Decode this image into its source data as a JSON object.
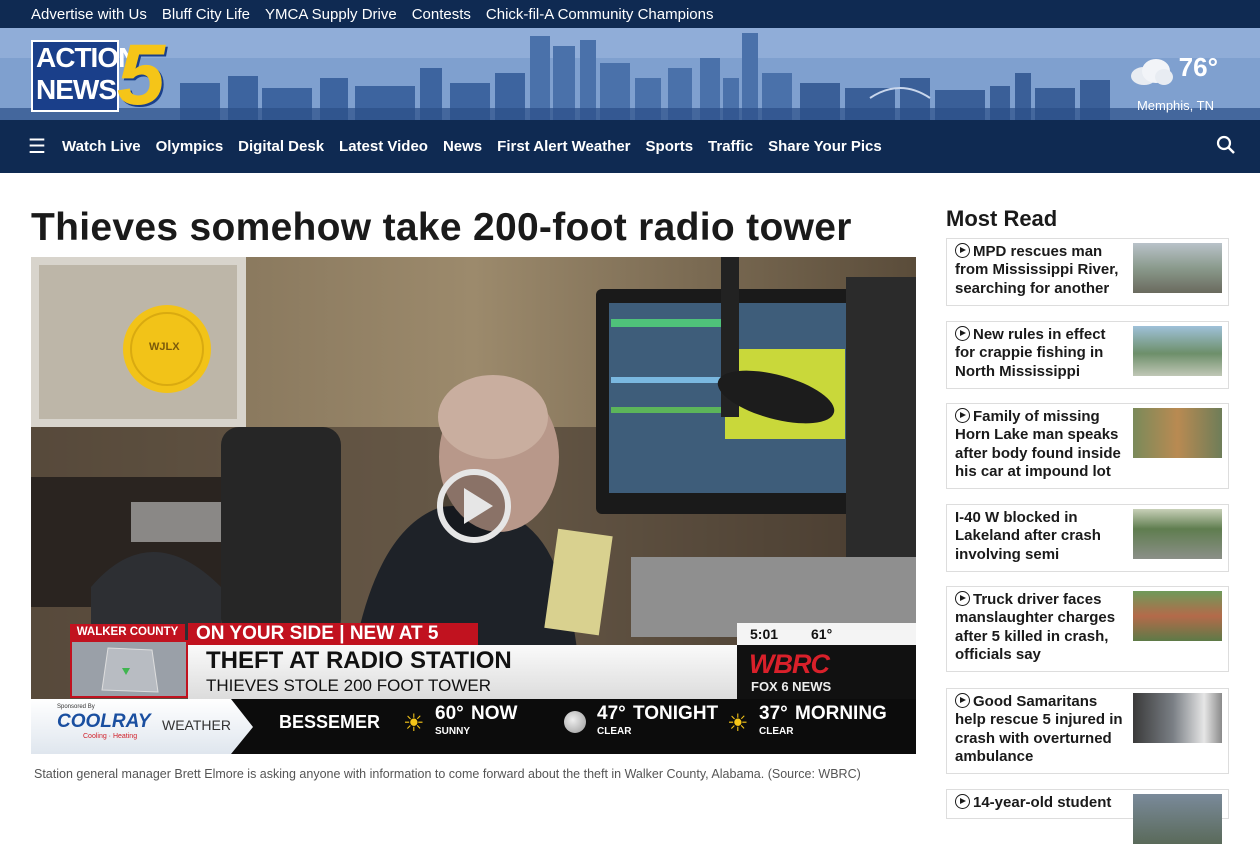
{
  "topbar": {
    "links": [
      "Advertise with Us",
      "Bluff City Life",
      "YMCA Supply Drive",
      "Contests",
      "Chick-fil-A Community Champions"
    ]
  },
  "logo": {
    "line1": "ACTION",
    "line2": "NEWS",
    "number": "5"
  },
  "weather": {
    "temp": "76°",
    "city": "Memphis, TN",
    "icon": "cloud-icon"
  },
  "nav": {
    "items": [
      "Watch Live",
      "Olympics",
      "Digital Desk",
      "Latest Video",
      "News",
      "First Alert Weather",
      "Sports",
      "Traffic",
      "Share Your Pics"
    ]
  },
  "article": {
    "headline": "Thieves somehow take 200-foot radio tower",
    "caption": "Station general manager Brett Elmore is asking anyone with information to come forward about the theft in Walker County, Alabama. (Source: WBRC)"
  },
  "video": {
    "frisbee_text": "WJLX",
    "county_tag": "WALKER COUNTY",
    "banner_top": "ON YOUR SIDE | NEW AT 5",
    "headline": "THEFT AT RADIO STATION",
    "subhead": "THIEVES STOLE 200 FOOT TOWER",
    "time": "5:01",
    "temp": "61°",
    "station": "WBRC",
    "station_sub": "FOX 6 NEWS",
    "sponsor_small": "Sponsored By",
    "sponsor": "COOLRAY",
    "sponsor_sub": "Cooling · Heating",
    "weather_label": "WEATHER",
    "city": "BESSEMER",
    "forecast": [
      {
        "temp": "60°",
        "when": "NOW",
        "cond": "SUNNY"
      },
      {
        "temp": "47°",
        "when": "TONIGHT",
        "cond": "CLEAR"
      },
      {
        "temp": "37°",
        "when": "MORNING",
        "cond": "CLEAR"
      }
    ]
  },
  "sidebar": {
    "title": "Most Read",
    "items": [
      {
        "text": "MPD rescues man from Mississippi River, searching for another",
        "video": true
      },
      {
        "text": "New rules in effect for crappie fishing in North Mississippi",
        "video": true
      },
      {
        "text": "Family of missing Horn Lake man speaks after body found inside his car at impound lot",
        "video": true
      },
      {
        "text": "I-40 W blocked in Lakeland after crash involving semi",
        "video": false
      },
      {
        "text": "Truck driver faces manslaughter charges after 5 killed in crash, officials say",
        "video": true
      },
      {
        "text": "Good Samaritans help rescue 5 injured in crash with overturned ambulance",
        "video": true
      },
      {
        "text": "14-year-old student",
        "video": true
      }
    ]
  }
}
